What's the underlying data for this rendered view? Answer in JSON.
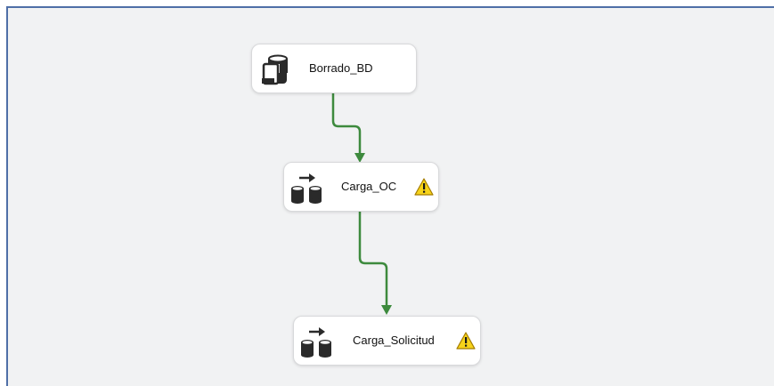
{
  "tasks": [
    {
      "name": "Borrado_BD",
      "icon": "execute-sql-task-icon",
      "warning": false
    },
    {
      "name": "Carga_OC",
      "icon": "data-flow-task-icon",
      "warning": true
    },
    {
      "name": "Carga_Solicitud",
      "icon": "data-flow-task-icon",
      "warning": true
    }
  ],
  "colors": {
    "canvas_background": "#f1f2f3",
    "canvas_border": "#4f6fa7",
    "precedence_success": "#3d8a3d",
    "warning_fill": "#f6d31a"
  }
}
